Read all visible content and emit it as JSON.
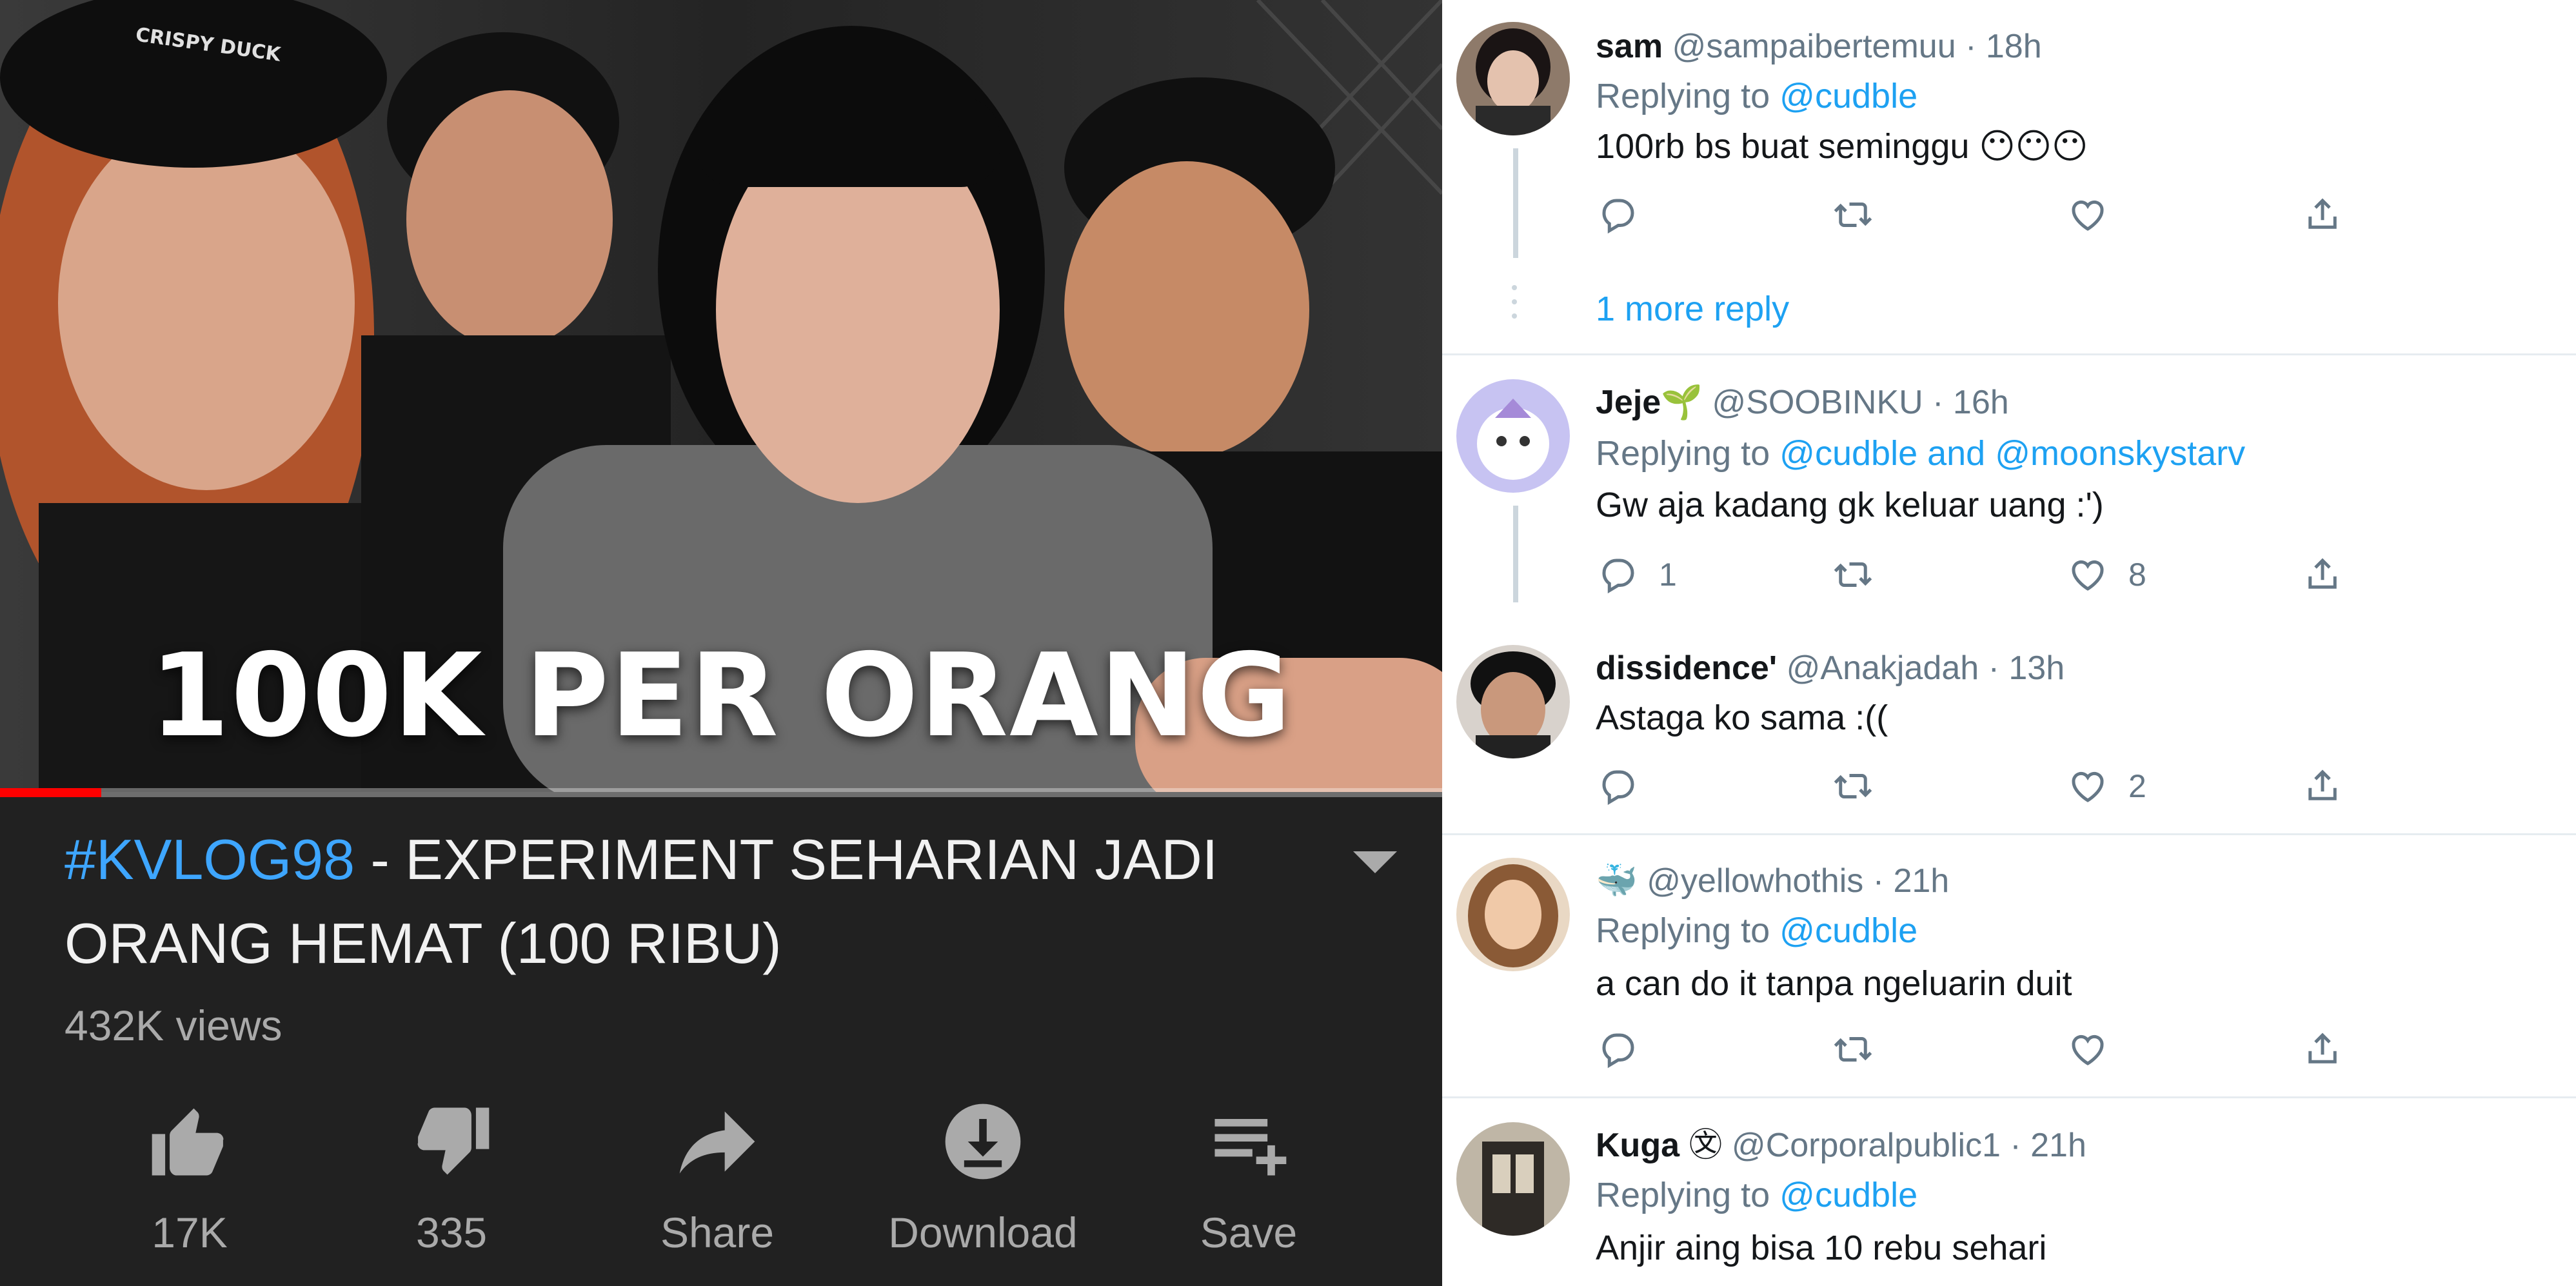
{
  "youtube": {
    "thumbnail_text": "100K PER ORANG",
    "cap_text": "CRISPY DUCK",
    "progress": 0.07,
    "title_hashtag": "#KVLOG98",
    "title_rest": " - EXPERIMENT SEHARIAN JADI ORANG HEMAT (100 RIBU)",
    "views": "432K views",
    "actions": [
      {
        "icon": "thumbs-up-icon",
        "label": "17K"
      },
      {
        "icon": "thumbs-down-icon",
        "label": "335"
      },
      {
        "icon": "share-icon",
        "label": "Share"
      },
      {
        "icon": "download-icon",
        "label": "Download"
      },
      {
        "icon": "save-playlist-icon",
        "label": "Save"
      }
    ],
    "colors": {
      "background": "#212121",
      "hashtag": "#3ea6ff",
      "progress": "#ff0000"
    }
  },
  "twitter": {
    "tweets": [
      {
        "name": "sam",
        "handle": "@sampaibertemuu",
        "time": "· 18h",
        "replying_prefix": "Replying to ",
        "replying_to": "@cudble",
        "text": "100rb bs buat seminggu 😶😶😶",
        "replies": "",
        "likes": ""
      },
      {
        "name": "Jeje",
        "name_emoji": "🌱",
        "handle": "@SOOBINKU",
        "time": "· 16h",
        "replying_prefix": "Replying to ",
        "replying_to": "@cudble and @moonskystarv",
        "text": "Gw aja kadang gk keluar uang :')",
        "replies": "1",
        "likes": "8"
      },
      {
        "name": "dissidence'",
        "handle": "@Anakjadah",
        "time": "· 13h",
        "text": "Astaga ko sama :((",
        "replies": "",
        "likes": "2"
      },
      {
        "name": "",
        "name_emoji": "🐳",
        "handle": "@yellowhothis",
        "time": "· 21h",
        "replying_prefix": "Replying to ",
        "replying_to": "@cudble",
        "text": "a can do it tanpa ngeluarin duit",
        "replies": "",
        "likes": ""
      },
      {
        "name": "Kuga",
        "name_emoji": "㉆",
        "handle": "@Corporalpublic1",
        "time": "· 21h",
        "replying_prefix": "Replying to ",
        "replying_to": "@cudble",
        "text": "Anjir aing bisa 10 rebu sehari"
      }
    ],
    "more_replies": "1 more reply",
    "colors": {
      "link": "#1da1f2",
      "secondary": "#657786",
      "primary": "#14171a"
    }
  }
}
